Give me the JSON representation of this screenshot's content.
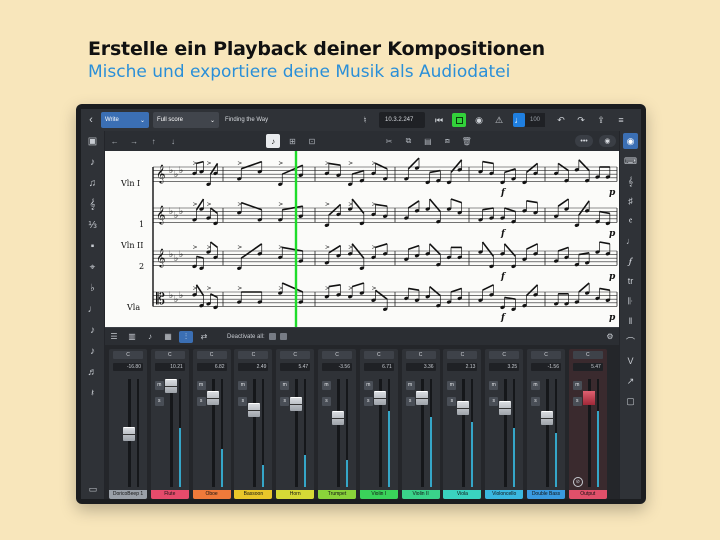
{
  "headline": "Erstelle ein Playback deiner Kompositionen",
  "subline": "Mische und exportiere deine Musik als Audiodatei",
  "toolbar": {
    "mode": "Write",
    "layout": "Full score",
    "project_title": "Finding the Way",
    "timecode": "10.3.2.247",
    "tempo": "100"
  },
  "mixer_bar": {
    "deactivate_label": "Deactivate all:",
    "m": "m",
    "s": "s"
  },
  "score": {
    "labels": [
      "Vln I",
      "1",
      "Vln II",
      "2",
      "Vla"
    ],
    "dynamic_marking": "f",
    "dynamic_p": "p"
  },
  "channels": [
    {
      "name": "DoricoBeep 1",
      "c": "C",
      "volume": "-16.80",
      "color": "#9aa0a8",
      "level": 0.0
    },
    {
      "name": "Flute",
      "c": "C",
      "volume": "10.21",
      "color": "#e54b6b",
      "level": 0.55
    },
    {
      "name": "Oboe",
      "c": "C",
      "volume": "6.82",
      "color": "#f07a3a",
      "level": 0.35
    },
    {
      "name": "Bassoon",
      "c": "C",
      "volume": "2.49",
      "color": "#e9c72a",
      "level": 0.2
    },
    {
      "name": "Horn",
      "c": "C",
      "volume": "5.47",
      "color": "#d6d936",
      "level": 0.3
    },
    {
      "name": "Trumpet",
      "c": "C",
      "volume": "-3.56",
      "color": "#8ad43a",
      "level": 0.25
    },
    {
      "name": "Violin I",
      "c": "C",
      "volume": "6.71",
      "color": "#3ad35a",
      "level": 0.7
    },
    {
      "name": "Violin II",
      "c": "C",
      "volume": "3.36",
      "color": "#3ad38a",
      "level": 0.65
    },
    {
      "name": "Viola",
      "c": "C",
      "volume": "2.13",
      "color": "#3ad3c0",
      "level": 0.6
    },
    {
      "name": "Violoncello",
      "c": "C",
      "volume": "3.25",
      "color": "#3ab8e0",
      "level": 0.55
    },
    {
      "name": "Double Bass",
      "c": "C",
      "volume": "-1.56",
      "color": "#3a9ae0",
      "level": 0.5
    },
    {
      "name": "Output",
      "c": "C",
      "volume": "5.47",
      "color": "#e0506a",
      "level": 0.7
    }
  ]
}
